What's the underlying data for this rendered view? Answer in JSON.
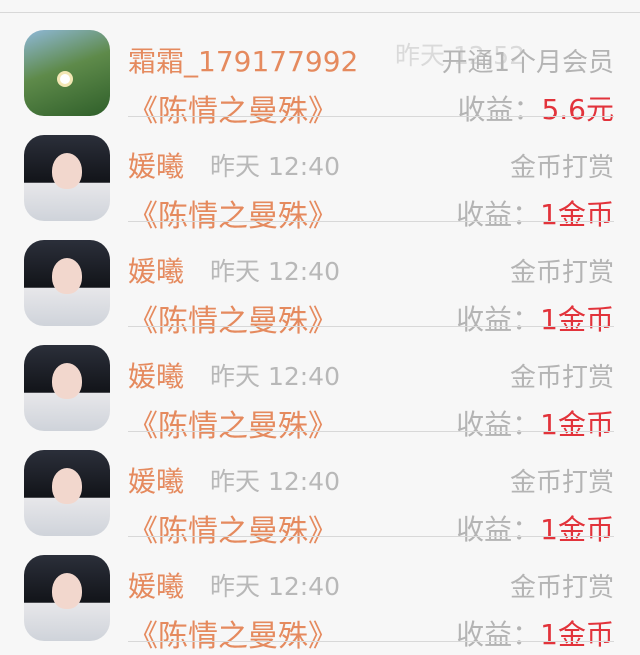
{
  "rows": [
    {
      "avatar": "nature-avatar",
      "name": "霜霜_179177992",
      "time": "昨天 12:52",
      "type": "开通1个月会员",
      "book": "《陈情之曼殊》",
      "income_label": "收益：",
      "income_value": "5.6元"
    },
    {
      "avatar": "portrait-avatar",
      "name": "媛曦",
      "time": "昨天 12:40",
      "type": "金币打赏",
      "book": "《陈情之曼殊》",
      "income_label": "收益：",
      "income_value": "1金币"
    },
    {
      "avatar": "portrait-avatar",
      "name": "媛曦",
      "time": "昨天 12:40",
      "type": "金币打赏",
      "book": "《陈情之曼殊》",
      "income_label": "收益：",
      "income_value": "1金币"
    },
    {
      "avatar": "portrait-avatar",
      "name": "媛曦",
      "time": "昨天 12:40",
      "type": "金币打赏",
      "book": "《陈情之曼殊》",
      "income_label": "收益：",
      "income_value": "1金币"
    },
    {
      "avatar": "portrait-avatar",
      "name": "媛曦",
      "time": "昨天 12:40",
      "type": "金币打赏",
      "book": "《陈情之曼殊》",
      "income_label": "收益：",
      "income_value": "1金币"
    },
    {
      "avatar": "portrait-avatar",
      "name": "媛曦",
      "time": "昨天 12:40",
      "type": "金币打赏",
      "book": "《陈情之曼殊》",
      "income_label": "收益：",
      "income_value": "1金币"
    }
  ]
}
